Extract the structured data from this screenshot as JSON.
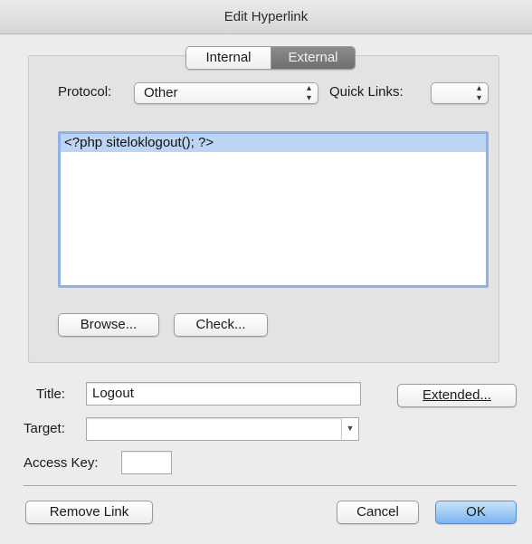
{
  "window": {
    "title": "Edit Hyperlink"
  },
  "tabs": {
    "internal": "Internal",
    "external": "External",
    "selected": "External"
  },
  "protocol": {
    "label": "Protocol:",
    "value": "Other"
  },
  "quick_links": {
    "label": "Quick Links:",
    "value": ""
  },
  "link_list": {
    "items": [
      "<?php siteloklogout(); ?>"
    ]
  },
  "buttons": {
    "browse": "Browse...",
    "check": "Check...",
    "extended": "Extended...",
    "remove_link": "Remove Link",
    "cancel": "Cancel",
    "ok": "OK"
  },
  "title_field": {
    "label": "Title:",
    "value": "Logout"
  },
  "target_field": {
    "label": "Target:",
    "value": ""
  },
  "access_key": {
    "label": "Access Key:",
    "value": ""
  },
  "icons": {
    "popup": "up-down-arrows",
    "combo": "down-triangle"
  },
  "colors": {
    "default_button": "#7bb4ee",
    "selection": "#bcd5f4",
    "focus_ring": "#8db2e3"
  }
}
